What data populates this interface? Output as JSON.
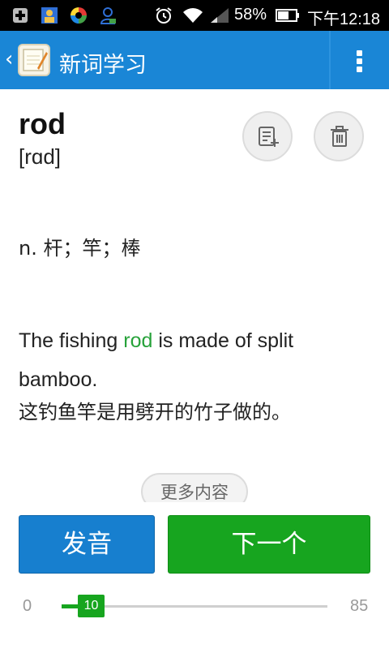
{
  "status_bar": {
    "battery": "58%",
    "time": "下午12:18",
    "icons": [
      "add-box-icon",
      "contacts-icon",
      "app-circle-icon",
      "person-notification-icon",
      "alarm-icon",
      "wifi-icon",
      "signal-icon",
      "battery-icon"
    ]
  },
  "app_bar": {
    "title": "新词学习",
    "back_icon": "chevron-left-icon",
    "menu_icon": "overflow-menu-icon"
  },
  "word": {
    "text": "rod",
    "phonetic": "[rɑd]",
    "definition": "n. 杆；竿；棒"
  },
  "example": {
    "before": "The fishing ",
    "highlight": "rod",
    "after": " is made of split bamboo.",
    "translation": "这钓鱼竿是用劈开的竹子做的。"
  },
  "actions": {
    "more_label": "更多内容",
    "pronounce_label": "发音",
    "next_label": "下一个",
    "add_note_icon": "add-to-notebook-icon",
    "delete_icon": "trash-icon"
  },
  "progress": {
    "min": "0",
    "max": "85",
    "current": "10"
  },
  "colors": {
    "app_bar": "#1a86d6",
    "highlight": "#27a23a",
    "primary_button": "#177fcf",
    "next_button": "#17a51f"
  }
}
